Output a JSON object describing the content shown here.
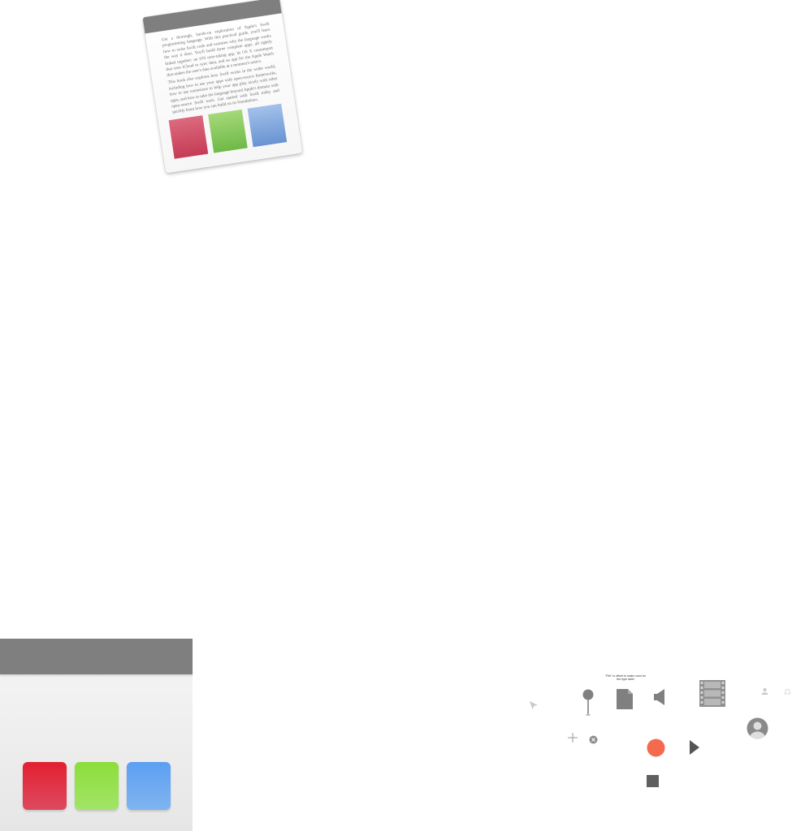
{
  "document": {
    "paragraphs": [
      "Get a thorough, hands-on exploration of Apple's Swift programming language. With this practical guide, you'll learn how to write Swift code and examine why the language works the way it does. You'll build three complete apps, all tightly linked together: an iOS note-taking app, its OS X counterpart that uses iCloud to sync data, and an app for the Apple Watch that makes the user's data available at a moment's notice.",
      "This book also explores how Swift works in the wider world, including how to use your apps with open-source frameworks, how to use extensions to help your app play nicely with other apps, and how to take the language beyond Apple's domain with open-source Swift tools. Get started with Swift today and quickly learn how you can build on its foundations."
    ]
  },
  "icons": {
    "note_text": "\"File\" is offset to make room for the type label"
  },
  "colors": {
    "header_gray": "#7f7f7f",
    "icon_gray": "#808080",
    "record_orange": "#f46a4e",
    "tile_red": "#e31f30",
    "tile_green": "#8cde3a",
    "tile_blue": "#5b9ff2"
  }
}
